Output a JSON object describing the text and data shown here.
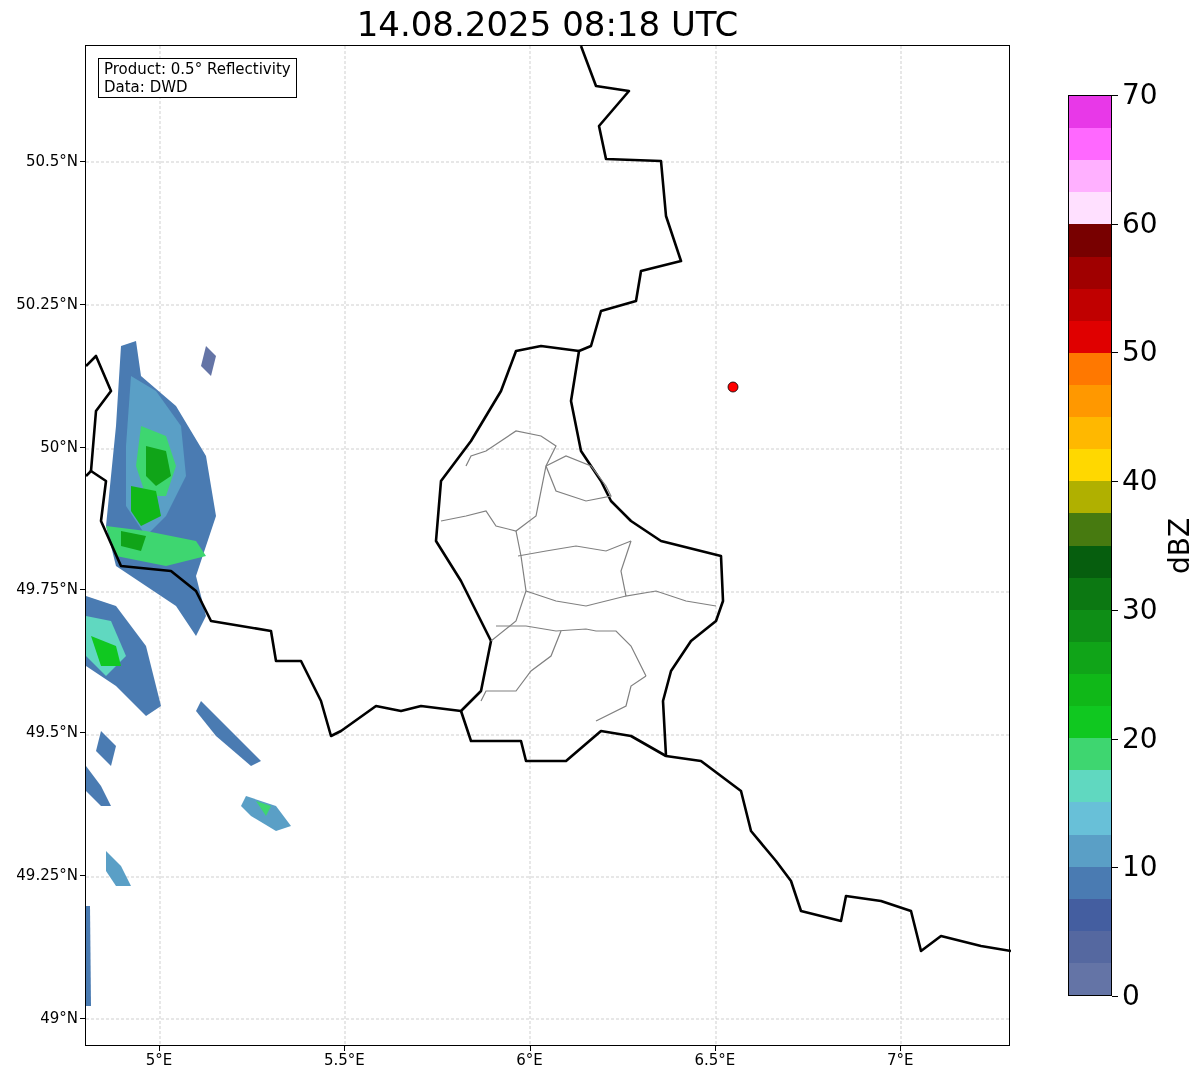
{
  "title": "14.08.2025 08:18 UTC",
  "map": {
    "legend": [
      "Product: 0.5° Reflectivity",
      "Data: DWD"
    ],
    "yticks": [
      "50.5°N",
      "50.25°N",
      "50°N",
      "49.75°N",
      "49.5°N",
      "49.25°N",
      "49°N"
    ],
    "xticks": [
      "5°E",
      "5.5°E",
      "6°E",
      "6.5°E",
      "7°E"
    ],
    "marker": {
      "color": "#ff0000"
    }
  },
  "colorbar": {
    "label": "dBZ",
    "ticks": [
      "70",
      "60",
      "50",
      "40",
      "30",
      "20",
      "10",
      "0"
    ],
    "segments": [
      {
        "color": "#e838e8"
      },
      {
        "color": "#ff68ff"
      },
      {
        "color": "#ffb0ff"
      },
      {
        "color": "#ffe0ff"
      },
      {
        "color": "#780000"
      },
      {
        "color": "#a00000"
      },
      {
        "color": "#c00000"
      },
      {
        "color": "#e00000"
      },
      {
        "color": "#ff7800"
      },
      {
        "color": "#ff9800"
      },
      {
        "color": "#ffb800"
      },
      {
        "color": "#ffd800"
      },
      {
        "color": "#b0b000"
      },
      {
        "color": "#477a10"
      },
      {
        "color": "#065e0e"
      },
      {
        "color": "#0c7812"
      },
      {
        "color": "#0e8e16"
      },
      {
        "color": "#10a418"
      },
      {
        "color": "#10b818"
      },
      {
        "color": "#10c820"
      },
      {
        "color": "#3ed670"
      },
      {
        "color": "#60d8c0"
      },
      {
        "color": "#68c0d8"
      },
      {
        "color": "#5a9fc6"
      },
      {
        "color": "#4a7bb2"
      },
      {
        "color": "#445ea0"
      },
      {
        "color": "#5568a0"
      },
      {
        "color": "#6474a6"
      }
    ]
  }
}
